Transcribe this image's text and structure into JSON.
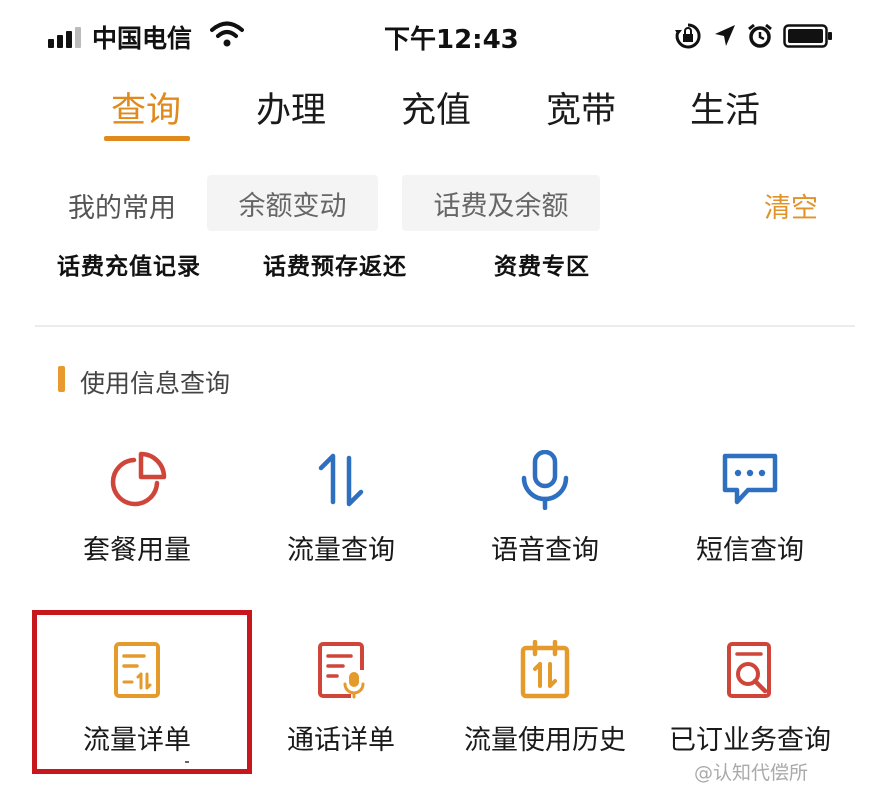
{
  "status_bar": {
    "carrier": "中国电信",
    "time": "下午12:43"
  },
  "tabs": [
    {
      "label": "查询",
      "active": true
    },
    {
      "label": "办理",
      "active": false
    },
    {
      "label": "充值",
      "active": false
    },
    {
      "label": "宽带",
      "active": false
    },
    {
      "label": "生活",
      "active": false
    }
  ],
  "favorites": {
    "label": "我的常用",
    "chips": [
      "余额变动",
      "话费及余额"
    ],
    "clear": "清空",
    "quick_links": [
      "话费充值记录",
      "话费预存返还",
      "资费专区"
    ]
  },
  "section": {
    "title": "使用信息查询"
  },
  "grid": [
    {
      "label": "套餐用量",
      "icon": "pie-chart-icon"
    },
    {
      "label": "流量查询",
      "icon": "up-down-arrows-icon"
    },
    {
      "label": "语音查询",
      "icon": "microphone-icon"
    },
    {
      "label": "短信查询",
      "icon": "message-bubble-icon"
    },
    {
      "label": "流量详单",
      "icon": "data-bill-icon"
    },
    {
      "label": "通话详单",
      "icon": "call-bill-icon"
    },
    {
      "label": "流量使用历史",
      "icon": "data-calendar-icon"
    },
    {
      "label": "已订业务查询",
      "icon": "search-document-icon"
    }
  ],
  "colors": {
    "accent": "#e08a1e",
    "highlight_border": "#c8161d",
    "icon_red": "#d0453a",
    "icon_blue": "#2f6fc0",
    "icon_orange": "#e59a2c"
  },
  "watermark": "@认知代偿所"
}
